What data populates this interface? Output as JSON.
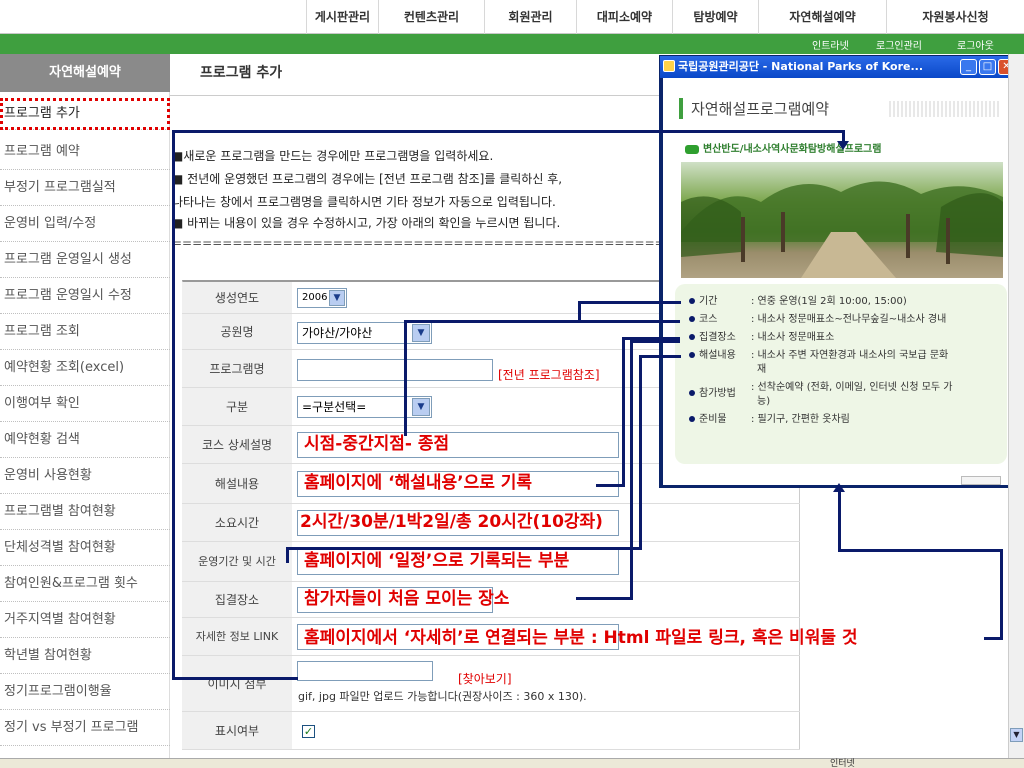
{
  "topnav": {
    "tabs": [
      "게시판관리",
      "컨텐츠관리",
      "회원관리",
      "대피소예약",
      "탐방예약",
      "자연해설예약",
      "자원봉사신청"
    ]
  },
  "utility": {
    "links": [
      "인트라넷",
      "로그인관리",
      "로그아웃"
    ]
  },
  "sidebar": {
    "header": "자연해설예약",
    "items": [
      "프로그램 추가",
      "프로그램 예약",
      "부정기 프로그램실적",
      "운영비 입력/수정",
      "프로그램 운영일시 생성",
      "프로그램 운영일시 수정",
      "프로그램 조회",
      "예약현황 조회(excel)",
      "이행여부 확인",
      "예약현황 검색",
      "운영비 사용현황",
      "프로그램별 참여현황",
      "단체성격별 참여현황",
      "참여인원&프로그램 횟수",
      "거주지역별 참여현황",
      "학년별 참여현황",
      "정기프로그램이행율",
      "정기 vs 부정기 프로그램"
    ]
  },
  "page": {
    "title": "프로그램 추가"
  },
  "instructions": [
    "■새로운 프로그램을 만드는 경우에만 프로그램명을 입력하세요.",
    "■ 전년에 운영했던 프로그램의 경우에는 [전년 프로그램 참조]를 클릭하신 후,",
    "  나타나는 창에서 프로그램명을 클릭하시면 기타 정보가 자동으로 입력됩니다.",
    "■ 바뀌는 내용이 있을 경우 수정하시고, 가장 아래의 확인을 누르시면 됩니다.",
    "======================================================================"
  ],
  "form": {
    "labels": [
      "생성연도",
      "공원명",
      "프로그램명",
      "구분",
      "코스 상세설명",
      "해설내용",
      "소요시간",
      "운영기간 및 시간",
      "집결장소",
      "자세한 정보 LINK",
      "이미지 첨부",
      "표시여부"
    ],
    "year": "2006",
    "park": "가야산/가야산",
    "program_name": "",
    "prev_ref_link": "[전년 프로그램참조]",
    "category": "=구분선택=",
    "browse_link": "[찾아보기]",
    "image_note": "gif, jpg 파일만 업로드 가능합니다(권장사이즈 : 360 x 130).",
    "display_checked": true
  },
  "annotations": {
    "course": "시점-중간지점- 종점",
    "content": "홈페이지에 ‘해설내용’으로 기록",
    "duration": "2시간/30분/1박2일/총 20시간(10강좌)",
    "schedule": "홈페이지에 ‘일정’으로 기록되는 부분",
    "meeting": "참가자들이 처음 모이는 장소",
    "link": "홈페이지에서 ‘자세히’로 연결되는 부분 : Html 파일로 링크, 혹은 비워둘 것"
  },
  "popup": {
    "window_title": "국립공원관리공단 - National Parks of Kore...",
    "heading": "자연해설프로그램예약",
    "subtitle": "변산반도/내소사역사문화탐방해설프로그램",
    "info": [
      {
        "key": "기간",
        "value": ": 연중 운영(1일 2회 10:00, 15:00)"
      },
      {
        "key": "코스",
        "value": ": 내소사 정문매표소~전나무숲길~내소사 경내"
      },
      {
        "key": "집결장소",
        "value": ": 내소사 정문매표소"
      },
      {
        "key": "해설내용",
        "value": ": 내소사 주변 자연환경과 내소사의 국보급 문화"
      },
      {
        "key": "",
        "value": "재"
      },
      {
        "key": "참가방법",
        "value": ": 선착순예약 (전화, 이메일, 인터넷 신청 모두 가"
      },
      {
        "key": "",
        "value": "능)"
      },
      {
        "key": "준비물",
        "value": ": 필기구, 간편한 옷차림"
      }
    ]
  },
  "statusbar": {
    "zone": "인터넷"
  },
  "colors": {
    "annotation": "#e00000",
    "connector": "#0a1a6a",
    "nav_green": "#3f9f3f",
    "sidebar_header": "#8a8a8a"
  }
}
